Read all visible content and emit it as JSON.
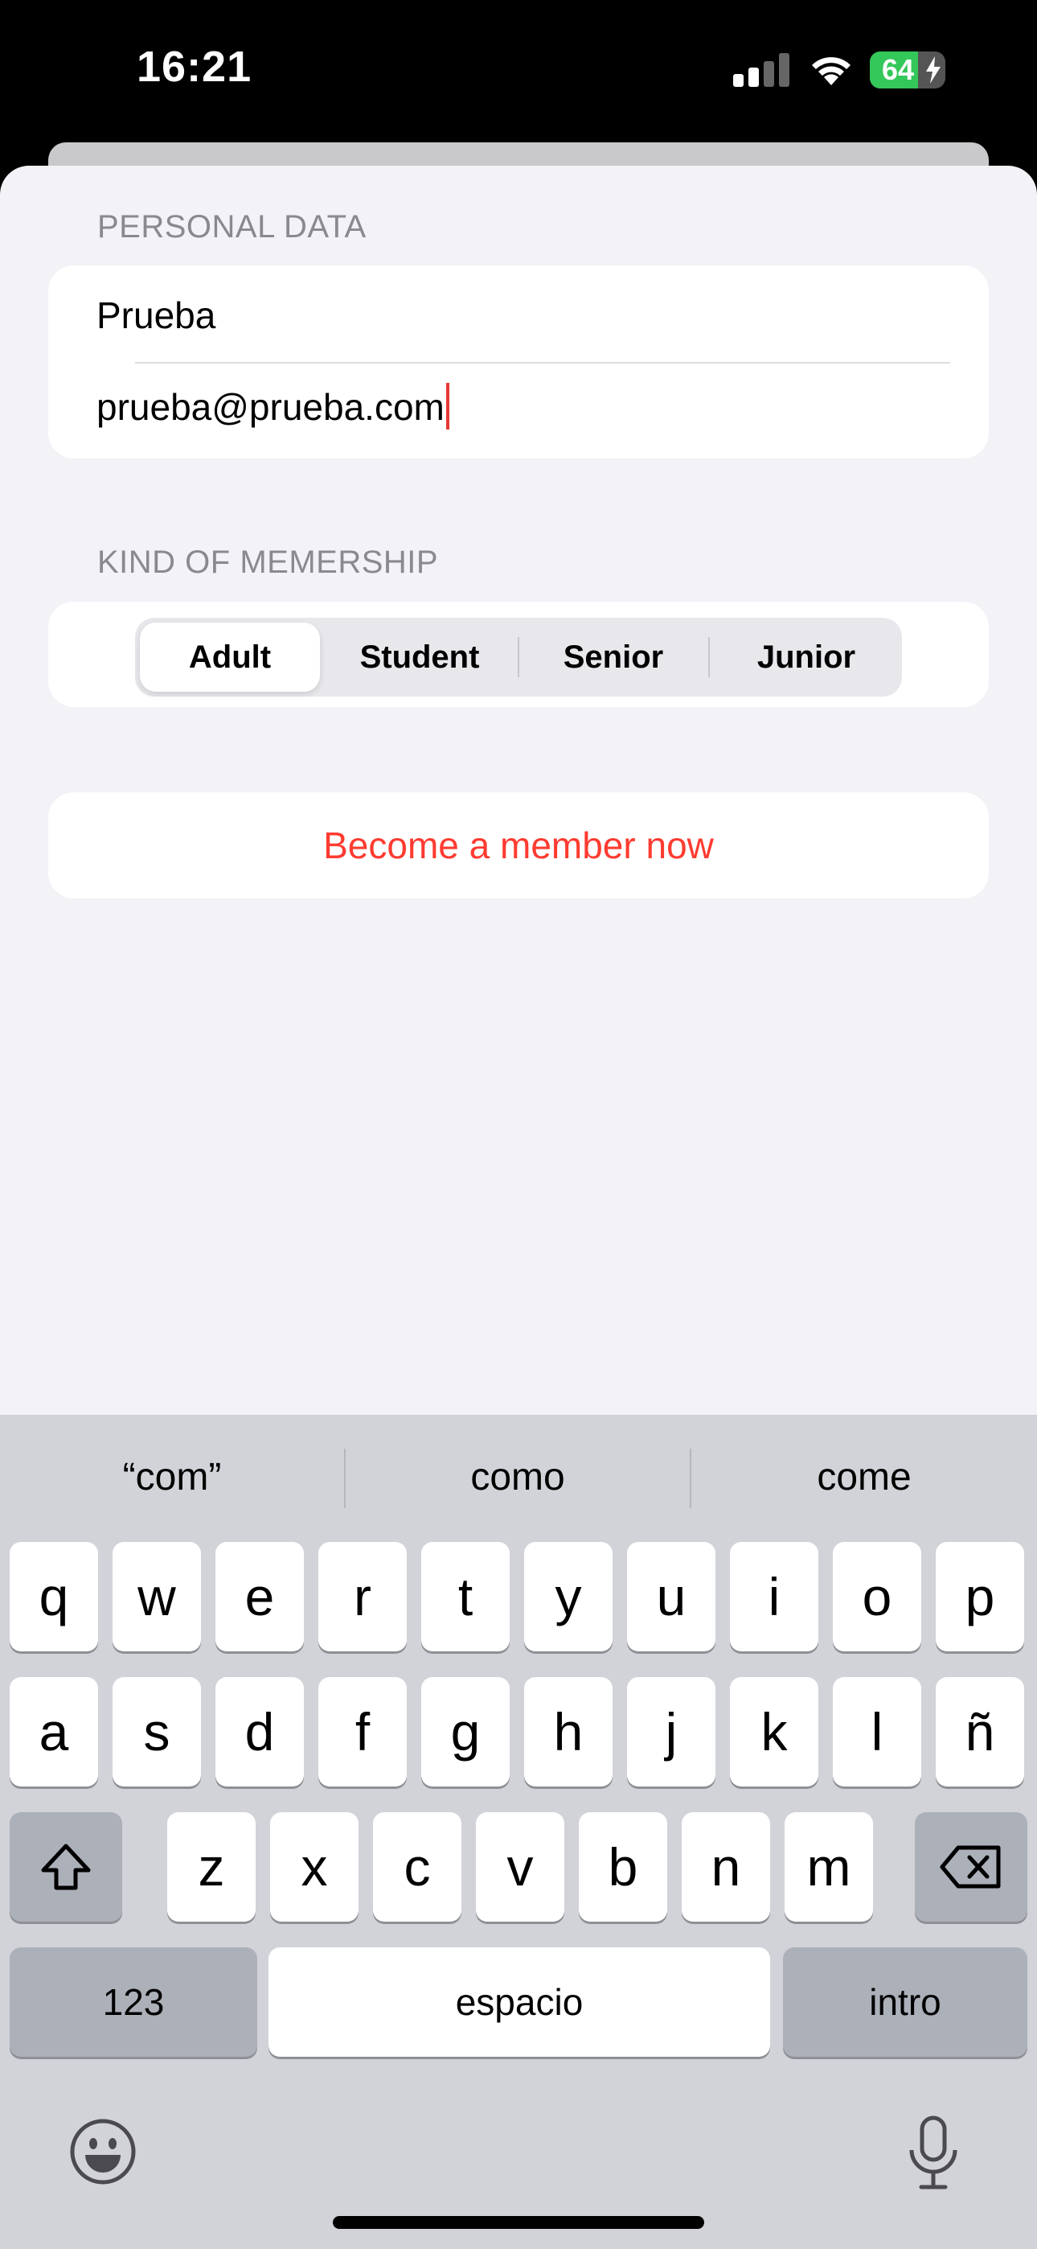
{
  "status_bar": {
    "time": "16:21",
    "battery_level": "64",
    "battery_fraction": 0.64,
    "icons": [
      "cellular-signal-icon",
      "wifi-icon",
      "battery-charging-icon"
    ]
  },
  "form": {
    "personal_data_header": "PERSONAL DATA",
    "name_value": "Prueba",
    "email_value": "prueba@prueba.com",
    "membership_header": "KIND OF MEMERSHIP",
    "membership_options": [
      "Adult",
      "Student",
      "Senior",
      "Junior"
    ],
    "selected_membership": "Adult",
    "submit_label": "Become a member now",
    "accent_color": "#ff3b30"
  },
  "keyboard": {
    "suggestions": [
      "“com”",
      "como",
      "come"
    ],
    "row1": [
      "q",
      "w",
      "e",
      "r",
      "t",
      "y",
      "u",
      "i",
      "o",
      "p"
    ],
    "row2": [
      "a",
      "s",
      "d",
      "f",
      "g",
      "h",
      "j",
      "k",
      "l",
      "ñ"
    ],
    "row3": [
      "z",
      "x",
      "c",
      "v",
      "b",
      "n",
      "m"
    ],
    "numbers_label": "123",
    "space_label": "espacio",
    "return_label": "intro",
    "icons": [
      "shift-icon",
      "delete-icon",
      "emoji-icon",
      "microphone-icon"
    ]
  }
}
